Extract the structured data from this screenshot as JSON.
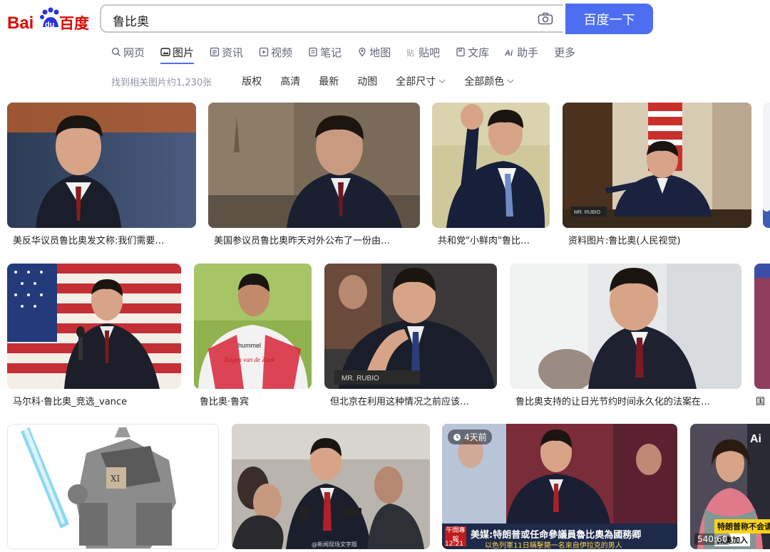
{
  "brand": {
    "logo_text_bai": "Bai",
    "logo_text_du": "du",
    "logo_text_cn": "百度"
  },
  "search": {
    "query": "鲁比奥",
    "button_label": "百度一下"
  },
  "tabs": [
    {
      "label": "网页",
      "icon": "search-icon"
    },
    {
      "label": "图片",
      "icon": "image-icon",
      "active": true
    },
    {
      "label": "资讯",
      "icon": "news-icon"
    },
    {
      "label": "视频",
      "icon": "video-icon"
    },
    {
      "label": "笔记",
      "icon": "note-icon"
    },
    {
      "label": "地图",
      "icon": "map-icon"
    },
    {
      "label": "贴吧",
      "icon": "tieba-icon"
    },
    {
      "label": "文库",
      "icon": "doc-icon"
    },
    {
      "label": "助手",
      "icon": "ai-icon"
    },
    {
      "label": "更多",
      "icon": ""
    }
  ],
  "filters": {
    "result_count": "找到相关图片约1,230张",
    "items": [
      "版权",
      "高清",
      "最新",
      "动图"
    ],
    "size_label": "全部尺寸",
    "color_label": "全部颜色"
  },
  "results": [
    {
      "caption": "美反华议员鲁比奥发文称:我们需要…"
    },
    {
      "caption": "美国参议员鲁比奥昨天对外公布了一份由…"
    },
    {
      "caption": "共和党\"小鲜肉\"鲁比…"
    },
    {
      "caption": "资料图片:鲁比奥(人民视觉)"
    },
    {
      "caption": "马尔科·鲁比奥_竞选_vance"
    },
    {
      "caption": "鲁比奥·鲁宾"
    },
    {
      "caption": "但北京在利用这种情况之前应该…"
    },
    {
      "caption": "鲁比奥支持的让日光节约时间永久化的法案在…"
    },
    {
      "caption": "国"
    },
    {
      "caption": ""
    },
    {
      "caption": ""
    },
    {
      "caption": ""
    },
    {
      "caption": ""
    }
  ],
  "thumb_text": {
    "nameplate_1": "MR. RUBIO",
    "nameplate_2": "MR. RUBIO",
    "jersey_sponsor": "hummel",
    "jersey_text": "Zuigen van de Zaak",
    "age_badge": "4天前",
    "news_headline": "美媒:特朗普或任命參議員魯比奧為國務卿",
    "news_sub": "以色列軍11日稱擊斃一名來自伊拉克的男人",
    "news_tag": "午間專報",
    "news_time": "12:21",
    "watermark": "@新闻现场文字版",
    "yellow_banner": "特朗普称不会请",
    "duration": "540:60",
    "bottom_strip": "佩奥加入"
  },
  "colors": {
    "accent": "#4e6ef2",
    "logo_red": "#e10601",
    "logo_blue": "#2932e1"
  }
}
